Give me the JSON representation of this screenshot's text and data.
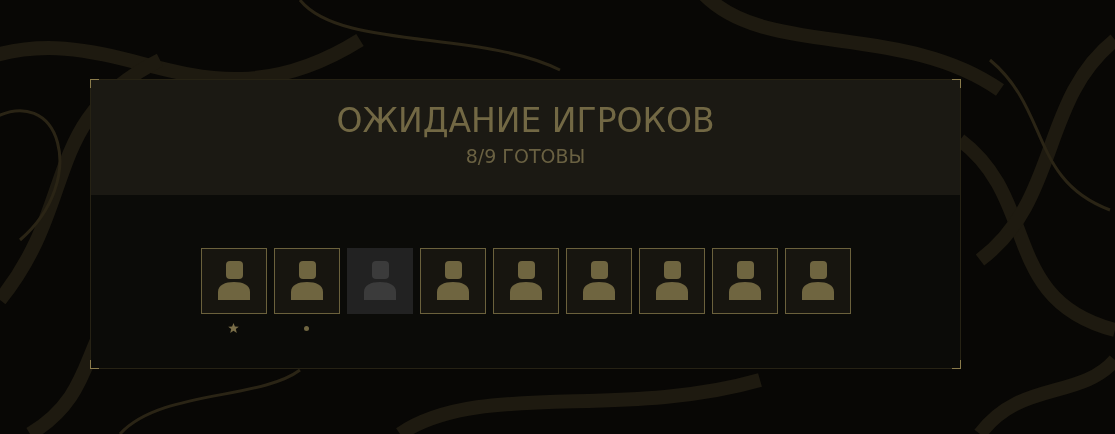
{
  "title": "ОЖИДАНИЕ ИГРОКОВ",
  "subtitle": "8/9 ГОТОВЫ",
  "players": [
    {
      "ready": true,
      "kind": "host"
    },
    {
      "ready": true,
      "kind": "self"
    },
    {
      "ready": false,
      "kind": "guest"
    },
    {
      "ready": true,
      "kind": "guest"
    },
    {
      "ready": true,
      "kind": "guest"
    },
    {
      "ready": true,
      "kind": "guest"
    },
    {
      "ready": true,
      "kind": "guest"
    },
    {
      "ready": true,
      "kind": "guest"
    },
    {
      "ready": true,
      "kind": "guest"
    }
  ]
}
